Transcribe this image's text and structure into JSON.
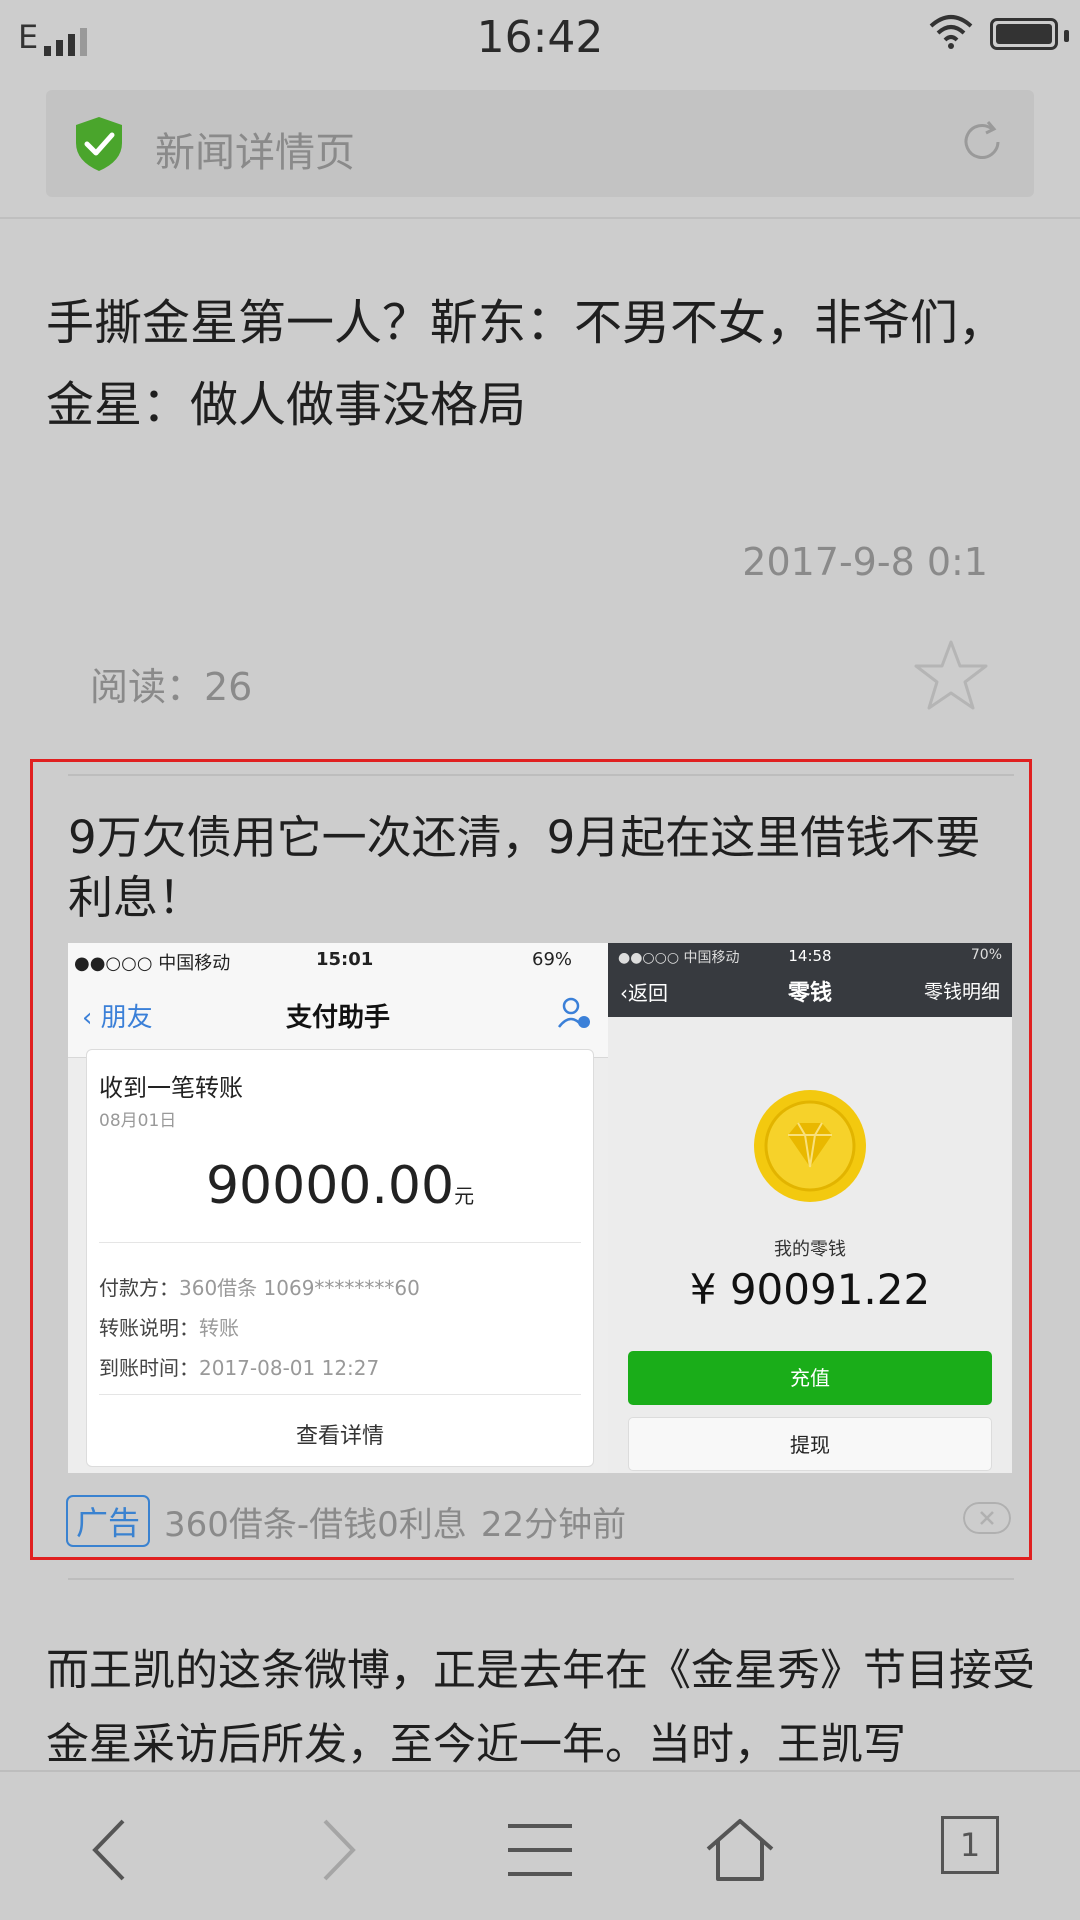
{
  "status_bar": {
    "network": "E",
    "time": "16:42"
  },
  "address_bar": {
    "title": "新闻详情页",
    "icons": [
      "shield-check-icon",
      "reload-icon"
    ]
  },
  "article": {
    "headline": "手撕金星第一人？靳东：不男不女，非爷们，金星：做人做事没格局",
    "date": "2017-9-8 0:1",
    "views": "阅读：26",
    "body": "而王凯的这条微博，正是去年在《金星秀》节目接受金星采访后所发，至今近一年。当时，王凯写"
  },
  "ad": {
    "title": "9万欠债用它一次还清，9月起在这里借钱不要利息！",
    "badge": "广告",
    "source": "360借条-借钱0利息",
    "time_ago": "22分钟前",
    "image": {
      "left": {
        "carrier": "●●○○○ 中国移动",
        "time": "15:01",
        "battery": "69%",
        "back": "朋友",
        "title": "支付助手",
        "card_title": "收到一笔转账",
        "card_date": "08月01日",
        "amount": "90000.00",
        "unit": "元",
        "payer_label": "付款方：",
        "payer": "360借条 1069********60",
        "memo_label": "转账说明：",
        "memo": "转账",
        "arrive_label": "到账时间：",
        "arrive": "2017-08-01 12:27",
        "details": "查看详情"
      },
      "right": {
        "carrier": "●●○○○ 中国移动",
        "time": "14:58",
        "battery": "70%",
        "back": "返回",
        "title": "零钱",
        "detail": "零钱明细",
        "label": "我的零钱",
        "amount": "¥ 90091.22",
        "recharge": "充值",
        "withdraw": "提现"
      }
    }
  },
  "toolbar": {
    "tab_count": "1",
    "icons": [
      "back-icon",
      "forward-icon",
      "menu-icon",
      "home-icon",
      "tabs-icon"
    ]
  },
  "colors": {
    "background": "#cdcdcd",
    "ad_border": "#e02020",
    "ad_badge": "#3a82d0",
    "shield": "#4aa52c",
    "wechat_green": "#1aad19"
  }
}
